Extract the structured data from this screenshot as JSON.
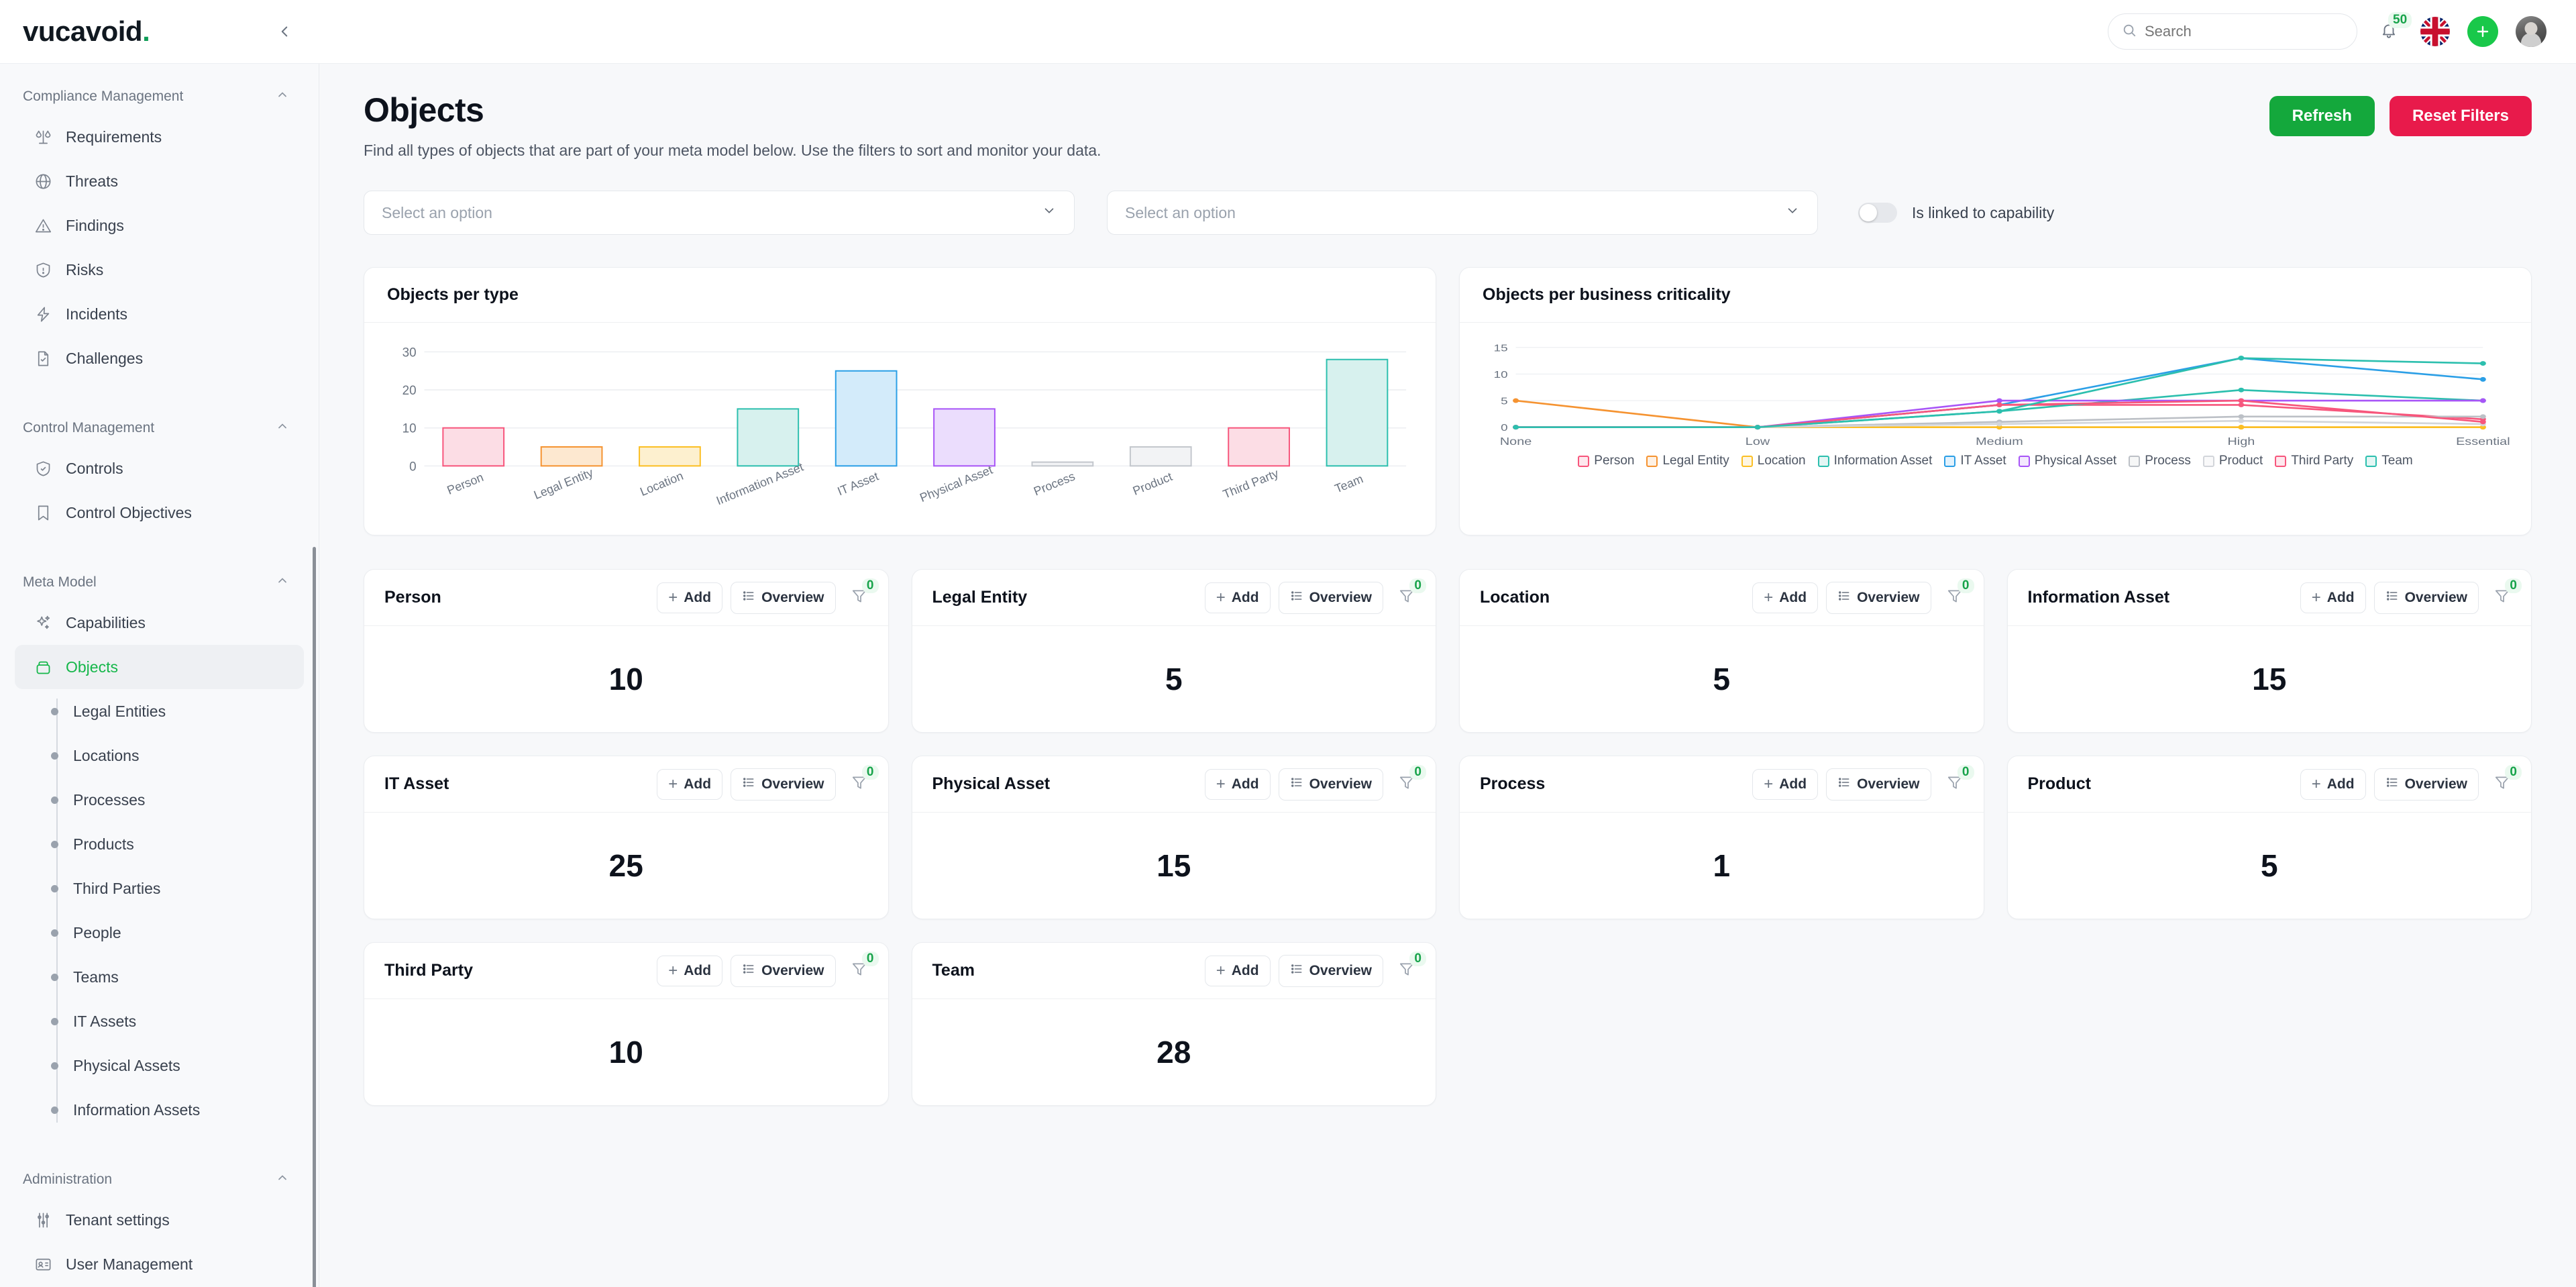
{
  "brand": {
    "name": "vucavoid",
    "dot": "."
  },
  "topbar": {
    "collapse_icon": "chevron-left-icon",
    "search": {
      "placeholder": "Search",
      "value": "",
      "icon": "search-icon"
    },
    "notifications": {
      "icon": "bell-icon",
      "count": "50"
    },
    "language": {
      "icon": "uk-flag-icon"
    },
    "add": {
      "icon": "plus-icon",
      "label": "+"
    },
    "avatar": {
      "icon": "user-avatar"
    }
  },
  "sidebar": {
    "groups": [
      {
        "label": "Compliance Management",
        "chevron": "chevron-up-icon",
        "items": [
          {
            "label": "Requirements",
            "icon": "scales-icon"
          },
          {
            "label": "Threats",
            "icon": "globe-icon"
          },
          {
            "label": "Findings",
            "icon": "warning-triangle-icon"
          },
          {
            "label": "Risks",
            "icon": "shield-alert-icon"
          },
          {
            "label": "Incidents",
            "icon": "bolt-icon"
          },
          {
            "label": "Challenges",
            "icon": "document-check-icon"
          }
        ]
      },
      {
        "label": "Control Management",
        "chevron": "chevron-up-icon",
        "items": [
          {
            "label": "Controls",
            "icon": "shield-check-icon"
          },
          {
            "label": "Control Objectives",
            "icon": "bookmark-icon"
          }
        ]
      },
      {
        "label": "Meta Model",
        "chevron": "chevron-up-icon",
        "items": [
          {
            "label": "Capabilities",
            "icon": "sparkles-icon"
          },
          {
            "label": "Objects",
            "icon": "box-icon",
            "active": true
          }
        ],
        "subitems": [
          {
            "label": "Legal Entities"
          },
          {
            "label": "Locations"
          },
          {
            "label": "Processes"
          },
          {
            "label": "Products"
          },
          {
            "label": "Third Parties"
          },
          {
            "label": "People"
          },
          {
            "label": "Teams"
          },
          {
            "label": "IT Assets"
          },
          {
            "label": "Physical Assets"
          },
          {
            "label": "Information Assets"
          }
        ]
      },
      {
        "label": "Administration",
        "chevron": "chevron-up-icon",
        "items": [
          {
            "label": "Tenant settings",
            "icon": "sliders-icon"
          },
          {
            "label": "User Management",
            "icon": "id-card-icon"
          }
        ]
      }
    ]
  },
  "page": {
    "title": "Objects",
    "subtitle": "Find all types of objects that are part of your meta model below. Use the filters to sort and monitor your data.",
    "refresh_label": "Refresh",
    "reset_label": "Reset Filters",
    "filter_one_placeholder": "Select an option",
    "filter_two_placeholder": "Select an option",
    "toggle_label": "Is linked to capability",
    "toggle_on": false
  },
  "colors": {
    "green": "#14a83c",
    "red": "#e81a4b",
    "accent_active": "#15b74a",
    "badge_bg": "#eaf9ef",
    "badge_text": "#17a34a"
  },
  "chart_data": [
    {
      "type": "bar",
      "title": "Objects per type",
      "categories": [
        "Person",
        "Legal Entity",
        "Location",
        "Information Asset",
        "IT Asset",
        "Physical Asset",
        "Process",
        "Product",
        "Third Party",
        "Team"
      ],
      "values": [
        10,
        5,
        5,
        15,
        25,
        15,
        1,
        5,
        10,
        28
      ],
      "colors": [
        "#f7567c",
        "#f59331",
        "#fbbf24",
        "#2cbfae",
        "#2b9fe6",
        "#a855f7",
        "#c3c7cd",
        "#c3c7cd",
        "#f7567c",
        "#2cbfae"
      ],
      "fills": [
        "#fcdde5",
        "#fde8d0",
        "#fdf0cf",
        "#d7f1ee",
        "#d3ebfa",
        "#ebddfd",
        "#f2f3f5",
        "#f2f3f5",
        "#fcdde5",
        "#d7f1ee"
      ],
      "xlabel": "",
      "ylabel": "",
      "yticks": [
        0,
        10,
        20,
        30
      ],
      "ylim": [
        0,
        32
      ],
      "grid": true,
      "legend": "none"
    },
    {
      "type": "line",
      "title": "Objects per business criticality",
      "x": [
        "None",
        "Low",
        "Medium",
        "High",
        "Essential"
      ],
      "yticks": [
        0,
        5,
        10,
        15
      ],
      "ylim": [
        0,
        16
      ],
      "grid": true,
      "legend": "bottom",
      "series": [
        {
          "name": "Person",
          "color": "#f7567c",
          "values": [
            0,
            0,
            4.2,
            4.2,
            1.5
          ]
        },
        {
          "name": "Legal Entity",
          "color": "#f59331",
          "values": [
            5,
            0,
            0,
            0,
            0
          ]
        },
        {
          "name": "Location",
          "color": "#fbbf24",
          "values": [
            0,
            0,
            0,
            0,
            0
          ]
        },
        {
          "name": "Information Asset",
          "color": "#2cbfae",
          "values": [
            0,
            0,
            3,
            7,
            5
          ]
        },
        {
          "name": "IT Asset",
          "color": "#2b9fe6",
          "values": [
            0,
            0,
            4.2,
            13,
            9
          ]
        },
        {
          "name": "Physical Asset",
          "color": "#a855f7",
          "values": [
            0,
            0,
            5,
            5,
            5
          ]
        },
        {
          "name": "Process",
          "color": "#bcc0c6",
          "values": [
            0,
            0,
            1,
            2,
            2
          ]
        },
        {
          "name": "Product",
          "color": "#d2d5da",
          "values": [
            0,
            0,
            0.6,
            1.2,
            0.6
          ]
        },
        {
          "name": "Third Party",
          "color": "#f7567c",
          "values": [
            0,
            0,
            4.2,
            5,
            1
          ]
        },
        {
          "name": "Team",
          "color": "#2cbfae",
          "values": [
            0,
            0,
            3,
            13,
            12
          ]
        }
      ]
    }
  ],
  "object_cards": {
    "add_label": "Add",
    "overview_label": "Overview",
    "filter_icon": "funnel-icon",
    "items": [
      {
        "title": "Person",
        "value": "10",
        "filter_count": "0"
      },
      {
        "title": "Legal Entity",
        "value": "5",
        "filter_count": "0"
      },
      {
        "title": "Location",
        "value": "5",
        "filter_count": "0"
      },
      {
        "title": "Information Asset",
        "value": "15",
        "filter_count": "0"
      },
      {
        "title": "IT Asset",
        "value": "25",
        "filter_count": "0"
      },
      {
        "title": "Physical Asset",
        "value": "15",
        "filter_count": "0"
      },
      {
        "title": "Process",
        "value": "1",
        "filter_count": "0"
      },
      {
        "title": "Product",
        "value": "5",
        "filter_count": "0"
      },
      {
        "title": "Third Party",
        "value": "10",
        "filter_count": "0"
      },
      {
        "title": "Team",
        "value": "28",
        "filter_count": "0"
      }
    ]
  }
}
